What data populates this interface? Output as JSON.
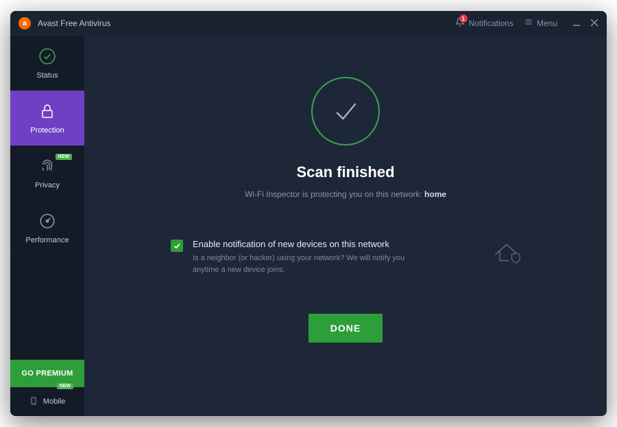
{
  "app": {
    "title": "Avast Free Antivirus"
  },
  "titlebar": {
    "notifications_label": "Notifications",
    "notifications_count": "1",
    "menu_label": "Menu"
  },
  "sidebar": {
    "items": [
      {
        "label": "Status"
      },
      {
        "label": "Protection"
      },
      {
        "label": "Privacy",
        "badge": "NEW"
      },
      {
        "label": "Performance"
      }
    ],
    "premium_label": "GO PREMIUM",
    "mobile_label": "Mobile",
    "mobile_badge": "NEW"
  },
  "main": {
    "heading": "Scan finished",
    "subtitle_prefix": "Wi-Fi Inspector is protecting you on this network: ",
    "subtitle_network": "home",
    "notification": {
      "checked": true,
      "title": "Enable notification of new devices on this network",
      "description": "Is a neighbor (or hacker) using your network? We will notify you anytime a new device joins."
    },
    "done_label": "DONE"
  },
  "colors": {
    "accent_green": "#2e9e3a",
    "accent_purple": "#6f40c4",
    "badge_red": "#e63946",
    "bg_dark": "#1a2332",
    "bg_main": "#1e2738"
  }
}
